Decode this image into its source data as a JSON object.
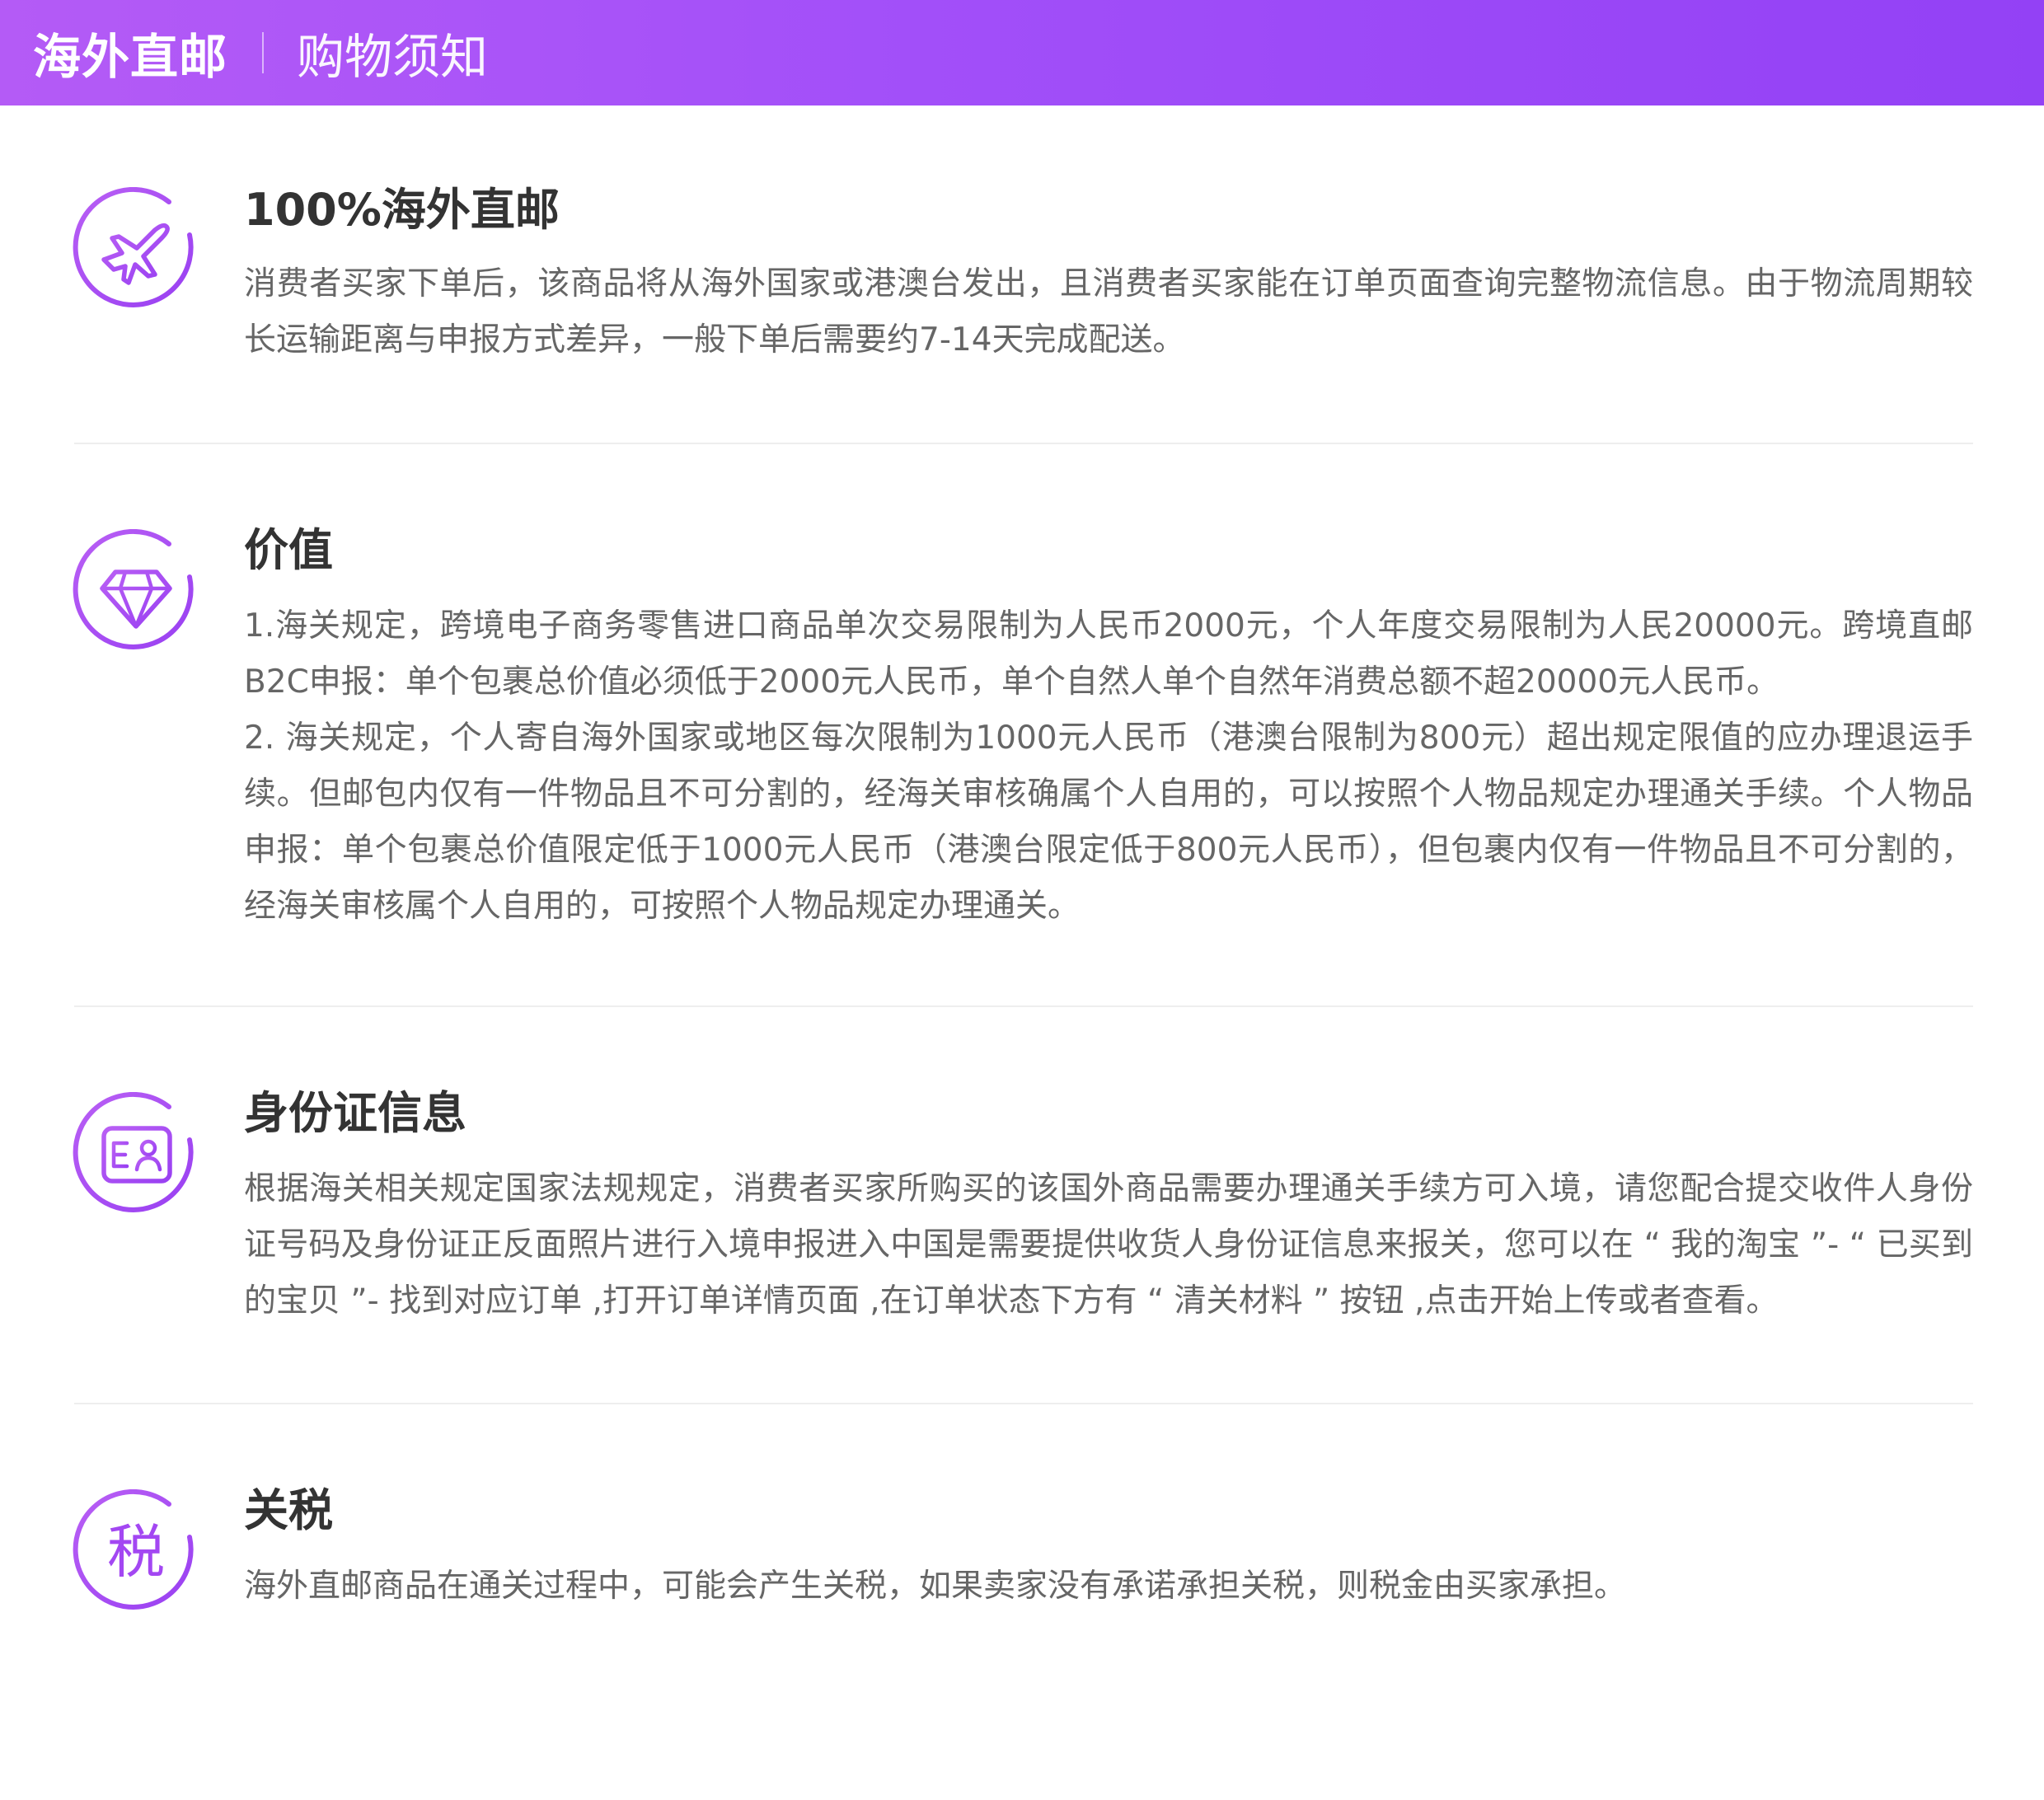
{
  "header": {
    "title": "海外直邮",
    "subtitle": "购物须知"
  },
  "colors": {
    "accent": "#a24ff9",
    "header_gradient_start": "#b45bf6",
    "header_gradient_end": "#9341f5",
    "icon_purple": "#a347f2",
    "title_text": "#333333",
    "body_text": "#666666",
    "divider": "#eeeeee"
  },
  "sections": [
    {
      "icon": "airplane-icon",
      "title": "100%海外直邮",
      "paragraphs": [
        "消费者买家下单后，该商品将从海外国家或港澳台发出，且消费者买家能在订单页面查询完整物流信息。由于物流周期较长运输距离与申报方式差异，一般下单后需要约7-14天完成配送。"
      ]
    },
    {
      "icon": "diamond-icon",
      "title": "价值",
      "paragraphs": [
        "1.海关规定，跨境电子商务零售进口商品单次交易限制为人民币2000元，个人年度交易限制为人民20000元。跨境直邮B2C申报：单个包裹总价值必须低于2000元人民币，单个自然人单个自然年消费总额不超20000元人民币。",
        "2. 海关规定，个人寄自海外国家或地区每次限制为1000元人民币（港澳台限制为800元）超出规定限值的应办理退运手续。但邮包内仅有一件物品且不可分割的，经海关审核确属个人自用的，可以按照个人物品规定办理通关手续。个人物品申报：单个包裹总价值限定低于1000元人民币（港澳台限定低于800元人民币），但包裹内仅有一件物品且不可分割的，经海关审核属个人自用的，可按照个人物品规定办理通关。"
      ]
    },
    {
      "icon": "id-card-icon",
      "title": "身份证信息",
      "paragraphs": [
        "根据海关相关规定国家法规规定，消费者买家所购买的该国外商品需要办理通关手续方可入境，请您配合提交收件人身份证号码及身份证正反面照片进行入境申报进入中国是需要提供收货人身份证信息来报关，您可以在 “ 我的淘宝 ”- “ 已买到的宝贝 ”- 找到对应订单 ,打开订单详情页面 ,在订单状态下方有 “ 清关材料 ” 按钮 ,点击开始上传或者查看。"
      ]
    },
    {
      "icon": "tax-icon",
      "icon_char": "税",
      "title": "关税",
      "paragraphs": [
        "海外直邮商品在通关过程中，可能会产生关税，如果卖家没有承诺承担关税，则税金由买家承担。"
      ]
    }
  ]
}
